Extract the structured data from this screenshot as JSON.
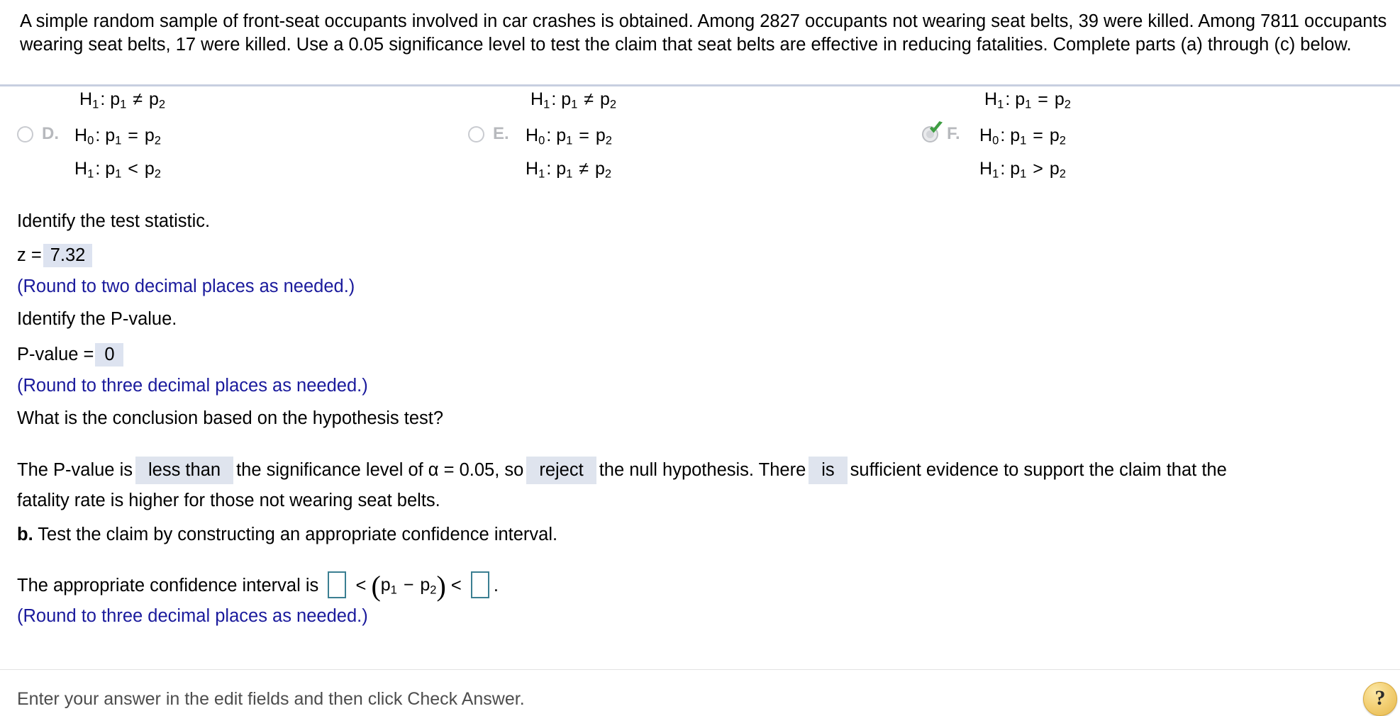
{
  "problem": {
    "statement": "A simple random sample of front-seat occupants involved in car crashes is obtained. Among 2827 occupants not wearing seat belts, 39 were killed. Among 7811 occupants wearing seat belts, 17 were killed. Use a 0.05 significance level to test the claim that seat belts are effective in reducing fatalities. Complete parts (a) through (c) below."
  },
  "choices": {
    "col1": {
      "tail_label": "H",
      "tail_sub": "1",
      "tail_rest": ": p",
      "tail_text": "H1: p1 ≠ p2",
      "letter": "D.",
      "null_text": "H0: p1 = p2",
      "alt_text": "H1: p1 < p2",
      "selected": "false",
      "null_sub": "0",
      "null_op": "=",
      "alt_sub": "1",
      "alt_op": "<"
    },
    "col2": {
      "tail_text": "H1: p1 ≠ p2",
      "letter": "E.",
      "null_text": "H0: p1 = p2",
      "alt_text": "H1: p1 ≠ p2",
      "selected": "false",
      "null_op": "=",
      "alt_op": "≠"
    },
    "col3": {
      "tail_text": "H1: p1 = p2",
      "letter": "F.",
      "null_text": "H0: p1 = p2",
      "alt_text": "H1: p1 > p2",
      "selected": "true",
      "null_op": "=",
      "alt_op": ">",
      "tail_op": "="
    }
  },
  "test_statistic": {
    "prompt": "Identify the test statistic.",
    "label": "z =",
    "value": "7.32",
    "hint": "(Round to two decimal places as needed.)"
  },
  "p_value": {
    "prompt": "Identify the P-value.",
    "label": "P-value =",
    "value": "0",
    "hint": "(Round to three decimal places as needed.)"
  },
  "conclusion": {
    "question": "What is the conclusion based on the hypothesis test?",
    "text_1": "The P-value is",
    "dropdown_1": "less than",
    "text_2": "the significance level of α = 0.05, so",
    "dropdown_2": "reject",
    "text_3": "the null hypothesis. There",
    "dropdown_3": "is",
    "text_4": "sufficient evidence to support the claim that the",
    "text_5": "fatality rate is higher for those not wearing seat belts."
  },
  "part_b": {
    "label": "b.",
    "text": "Test the claim by constructing an appropriate confidence interval.",
    "ci_prefix": "The appropriate confidence interval is",
    "ci_lower_value": "",
    "ci_upper_value": "",
    "lt_1": "<",
    "lt_2": "<",
    "expr_p1": "p",
    "expr_sub1": "1",
    "expr_minus": "−",
    "expr_p2": "p",
    "expr_sub2": "2",
    "period": ".",
    "hint": "(Round to three decimal places as needed.)"
  },
  "footer": {
    "text": "Enter your answer in the edit fields and then click Check Answer.",
    "help_glyph": "?"
  }
}
